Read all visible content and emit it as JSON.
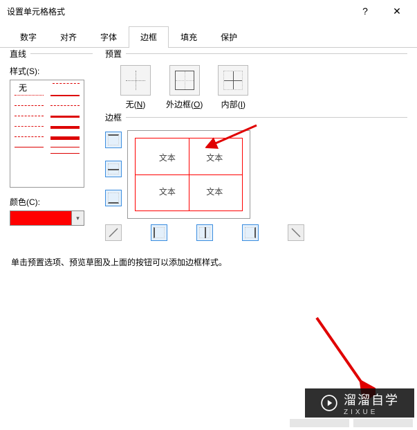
{
  "window": {
    "title": "设置单元格格式",
    "help_glyph": "?",
    "close_glyph": "✕"
  },
  "tabs": [
    {
      "label": "数字"
    },
    {
      "label": "对齐"
    },
    {
      "label": "字体"
    },
    {
      "label": "边框",
      "active": true
    },
    {
      "label": "填充"
    },
    {
      "label": "保护"
    }
  ],
  "line": {
    "group_title": "直线",
    "style_label": "样式(S):",
    "none_label": "无",
    "color_label": "颜色(C):",
    "color_hex": "#ff0000"
  },
  "preset": {
    "group_title": "预置",
    "none": {
      "label": "无",
      "accel": "N"
    },
    "outline": {
      "label": "外边框",
      "accel": "O"
    },
    "inside": {
      "label": "内部",
      "accel": "I"
    }
  },
  "border": {
    "group_title": "边框",
    "sample_text": "文本"
  },
  "hint": "单击预置选项、预览草图及上面的按钮可以添加边框样式。",
  "watermark": {
    "brand": "溜溜自学",
    "sub": "ZIXUE"
  }
}
